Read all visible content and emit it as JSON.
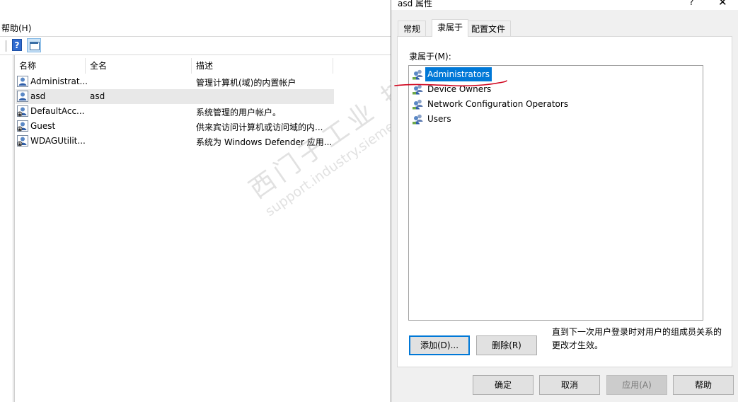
{
  "background_window": {
    "menu_help": "帮助(H)",
    "columns": [
      "名称",
      "全名",
      "描述"
    ],
    "rows": [
      {
        "name": "Administrat...",
        "fullname": "",
        "description": "管理计算机(域)的内置帐户",
        "selected": false
      },
      {
        "name": "asd",
        "fullname": "asd",
        "description": "",
        "selected": true
      },
      {
        "name": "DefaultAcc...",
        "fullname": "",
        "description": "系统管理的用户帐户。",
        "selected": false
      },
      {
        "name": "Guest",
        "fullname": "",
        "description": "供来宾访问计算机或访问域的内...",
        "selected": false
      },
      {
        "name": "WDAGUtilit...",
        "fullname": "",
        "description": "系统为 Windows Defender 应用...",
        "selected": false
      }
    ]
  },
  "dialog": {
    "title": "asd 属性",
    "help_glyph": "?",
    "close_glyph": "✕",
    "tabs": [
      "常规",
      "隶属于",
      "配置文件"
    ],
    "active_tab": "隶属于",
    "memberof_label": "隶属于(M):",
    "groups": [
      {
        "name": "Administrators",
        "selected": true
      },
      {
        "name": "Device Owners",
        "selected": false
      },
      {
        "name": "Network Configuration Operators",
        "selected": false
      },
      {
        "name": "Users",
        "selected": false
      }
    ],
    "add_button": "添加(D)...",
    "remove_button": "删除(R)",
    "note": "直到下一次用户登录时对用户的组成员关系的更改才生效。",
    "ok_button": "确定",
    "cancel_button": "取消",
    "apply_button": "应用(A)",
    "help_button": "帮助",
    "annotation_color": "#d0021b",
    "selection_color": "#0078d7"
  },
  "watermark": {
    "line1": "西门子工业 技术论坛",
    "line2": "support.industry.siemens.com/cs"
  }
}
